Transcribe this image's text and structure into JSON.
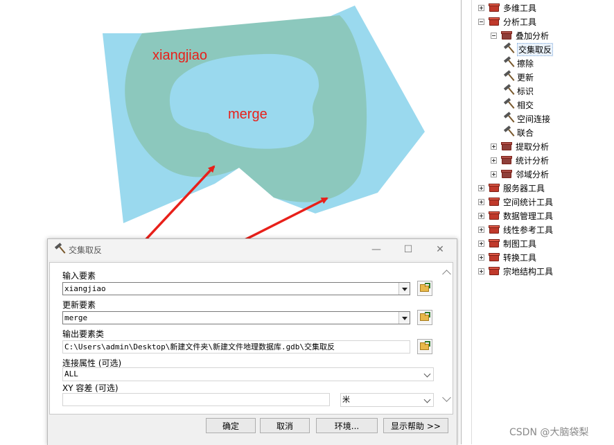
{
  "map": {
    "label_input": "xiangjiao",
    "label_update": "merge",
    "colors": {
      "outer": "#9ad9ee",
      "ring": "#8cc8bd",
      "annotation": "#e8201a"
    }
  },
  "toolbox": {
    "items": [
      {
        "label": "多维工具",
        "icon": "toolbox-icon",
        "expander": "plus"
      },
      {
        "label": "分析工具",
        "icon": "toolbox-icon",
        "expander": "minus"
      },
      {
        "label": "叠加分析",
        "icon": "toolset-icon",
        "expander": "minus"
      },
      {
        "label": "交集取反",
        "icon": "hammer-icon",
        "selected": true
      },
      {
        "label": "擦除",
        "icon": "hammer-icon"
      },
      {
        "label": "更新",
        "icon": "hammer-icon"
      },
      {
        "label": "标识",
        "icon": "hammer-icon"
      },
      {
        "label": "相交",
        "icon": "hammer-icon"
      },
      {
        "label": "空间连接",
        "icon": "hammer-icon"
      },
      {
        "label": "联合",
        "icon": "hammer-icon"
      },
      {
        "label": "提取分析",
        "icon": "toolset-icon",
        "expander": "plus"
      },
      {
        "label": "统计分析",
        "icon": "toolset-icon",
        "expander": "plus"
      },
      {
        "label": "邻域分析",
        "icon": "toolset-icon",
        "expander": "plus"
      },
      {
        "label": "服务器工具",
        "icon": "toolbox-icon",
        "expander": "plus"
      },
      {
        "label": "空间统计工具",
        "icon": "toolbox-icon",
        "expander": "plus"
      },
      {
        "label": "数据管理工具",
        "icon": "toolbox-icon",
        "expander": "plus"
      },
      {
        "label": "线性参考工具",
        "icon": "toolbox-icon",
        "expander": "plus"
      },
      {
        "label": "制图工具",
        "icon": "toolbox-icon",
        "expander": "plus"
      },
      {
        "label": "转换工具",
        "icon": "toolbox-icon",
        "expander": "plus"
      },
      {
        "label": "宗地结构工具",
        "icon": "toolbox-icon",
        "expander": "plus"
      }
    ]
  },
  "dialog": {
    "title": "交集取反",
    "title_icon": "hammer-icon",
    "window_buttons": {
      "minimize": "—",
      "maximize": "☐",
      "close": "✕"
    },
    "fields": {
      "input_features": {
        "label": "输入要素",
        "value": "xiangjiao"
      },
      "update_features": {
        "label": "更新要素",
        "value": "merge"
      },
      "output_feature_class": {
        "label": "输出要素类",
        "value": "C:\\Users\\admin\\Desktop\\新建文件夹\\新建文件地理数据库.gdb\\交集取反"
      },
      "join_attributes": {
        "label": "连接属性 (可选)",
        "value": "ALL"
      },
      "xy_tolerance": {
        "label": "XY 容差 (可选)",
        "value": "",
        "unit": "米"
      }
    },
    "buttons": {
      "ok": "确定",
      "cancel": "取消",
      "environments": "环境...",
      "show_help": "显示帮助 >>"
    }
  },
  "watermark": "CSDN @大脑袋梨"
}
